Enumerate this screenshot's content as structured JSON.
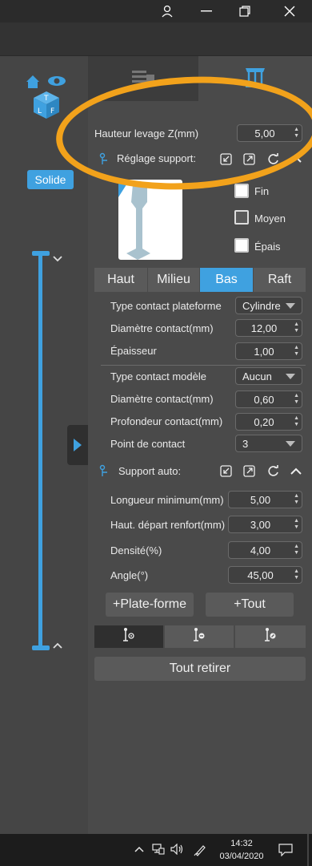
{
  "window": {
    "user_icon": "person-icon",
    "minimize_icon": "minimize-icon",
    "restore_icon": "restore-icon",
    "close_icon": "close-icon"
  },
  "left": {
    "solid_label": "Solide"
  },
  "lift": {
    "label": "Hauteur levage Z(mm)",
    "value": "5,00"
  },
  "support_settings": {
    "title": "Réglage support:",
    "options": [
      "Fin",
      "Moyen",
      "Épais"
    ]
  },
  "tabs": [
    "Haut",
    "Milieu",
    "Bas",
    "Raft"
  ],
  "active_tab": "Bas",
  "bas": {
    "contact_type_label": "Type contact plateforme",
    "contact_type_value": "Cylindre",
    "contact_diameter_label": "Diamètre contact(mm)",
    "contact_diameter_value": "12,00",
    "thickness_label": "Épaisseur",
    "thickness_value": "1,00"
  },
  "model": {
    "contact_type_label": "Type contact modèle",
    "contact_type_value": "Aucun",
    "contact_diameter_label": "Diamètre contact(mm)",
    "contact_diameter_value": "0,60",
    "depth_label": "Profondeur contact(mm)",
    "depth_value": "0,20",
    "point_label": "Point de contact",
    "point_value": "3"
  },
  "auto": {
    "title": "Support auto:",
    "min_length_label": "Longueur minimum(mm)",
    "min_length_value": "5,00",
    "reinforce_label": "Haut. départ renfort(mm)",
    "reinforce_value": "3,00",
    "density_label": "Densité(%)",
    "density_value": "4,00",
    "angle_label": "Angle(°)",
    "angle_value": "45,00"
  },
  "buttons": {
    "platform": "+Plate-forme",
    "all": "+Tout",
    "remove_all": "Tout retirer"
  },
  "taskbar": {
    "time": "14:32",
    "date": "03/04/2020"
  },
  "colors": {
    "accent": "#3fa1e0",
    "annotation": "#f2a21b"
  }
}
